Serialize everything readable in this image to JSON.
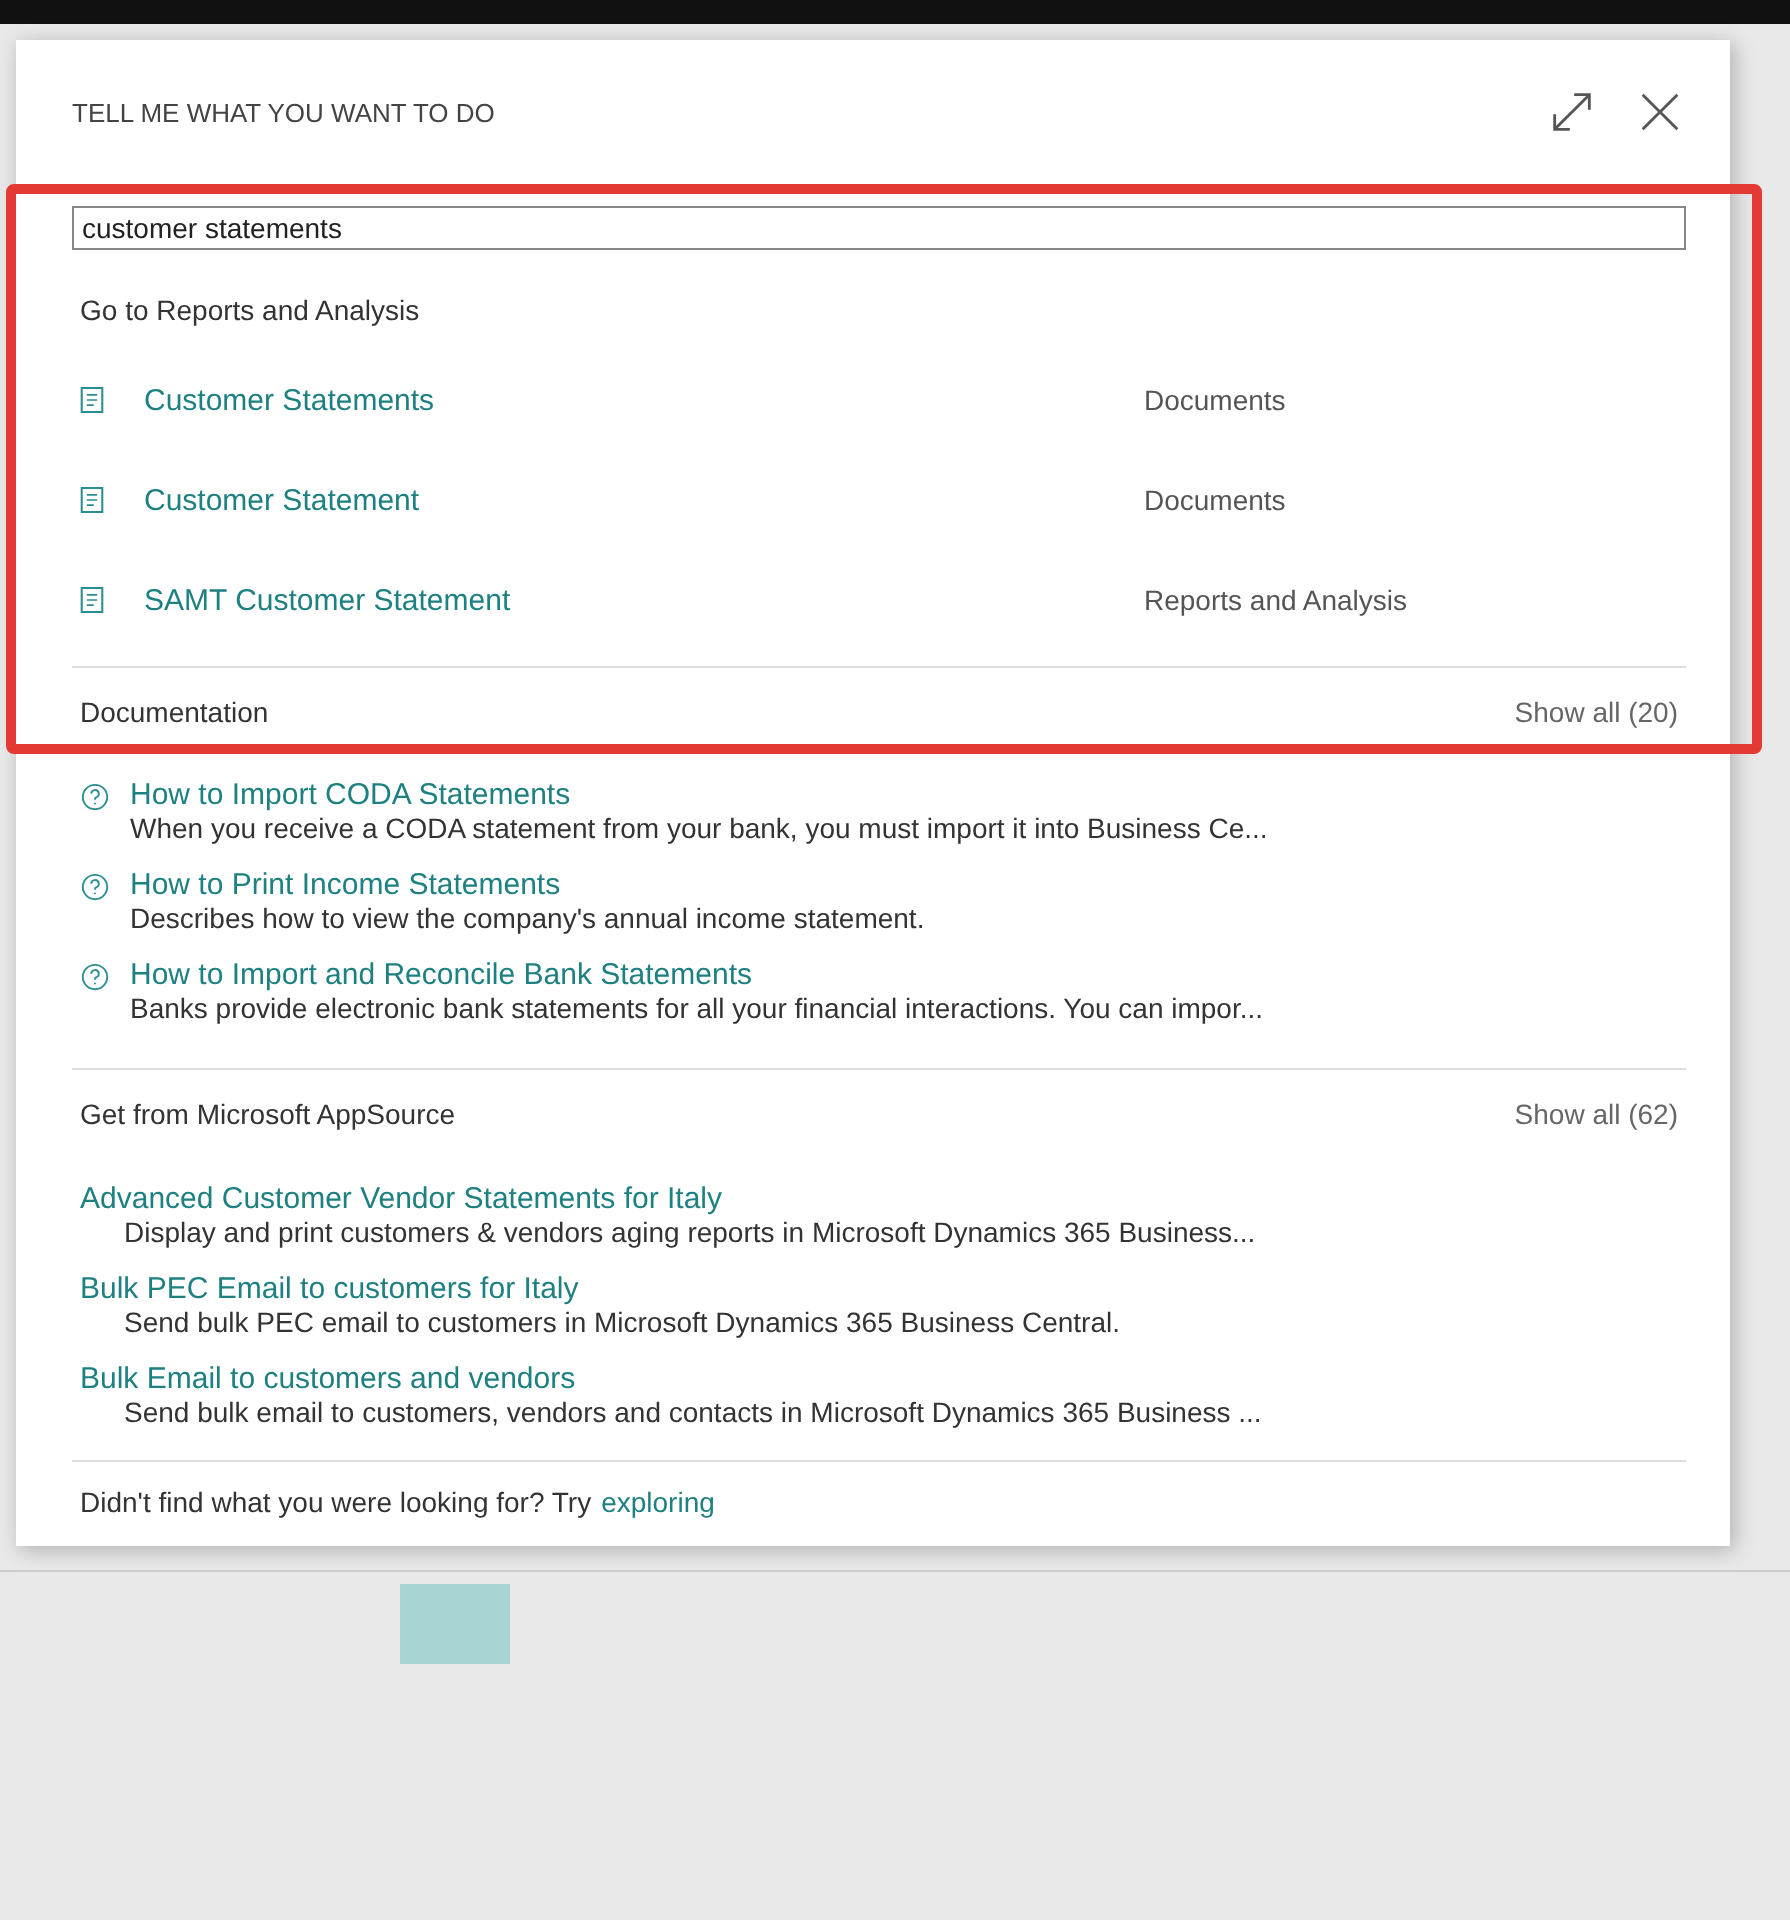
{
  "dialog": {
    "title": "TELL ME WHAT YOU WANT TO DO"
  },
  "search": {
    "value": "customer statements"
  },
  "reports": {
    "heading": "Go to Reports and Analysis",
    "items": [
      {
        "label": "Customer Statements",
        "category": "Documents"
      },
      {
        "label": "Customer Statement",
        "category": "Documents"
      },
      {
        "label": "SAMT Customer Statement",
        "category": "Reports and Analysis"
      }
    ]
  },
  "documentation": {
    "heading": "Documentation",
    "show_all": "Show all (20)",
    "items": [
      {
        "title": "How to Import CODA Statements",
        "description": "When you receive a CODA statement from your bank, you must import it into Business Ce..."
      },
      {
        "title": "How to Print Income Statements",
        "description": "Describes how to view the company's annual income statement."
      },
      {
        "title": "How to Import and Reconcile Bank Statements",
        "description": "Banks provide electronic bank statements for all your financial interactions. You can impor..."
      }
    ]
  },
  "appsource": {
    "heading": "Get from Microsoft AppSource",
    "show_all": "Show all (62)",
    "items": [
      {
        "title": "Advanced Customer Vendor Statements for Italy",
        "description": "Display and print customers & vendors aging reports in Microsoft Dynamics 365 Business..."
      },
      {
        "title": "Bulk PEC Email to customers for Italy",
        "description": "Send bulk PEC email to customers in Microsoft Dynamics 365 Business Central."
      },
      {
        "title": "Bulk Email to customers and vendors",
        "description": "Send bulk email to customers, vendors and contacts in Microsoft Dynamics 365 Business ..."
      }
    ]
  },
  "footer": {
    "text": "Didn't find what you were looking for? Try",
    "link": "exploring"
  }
}
